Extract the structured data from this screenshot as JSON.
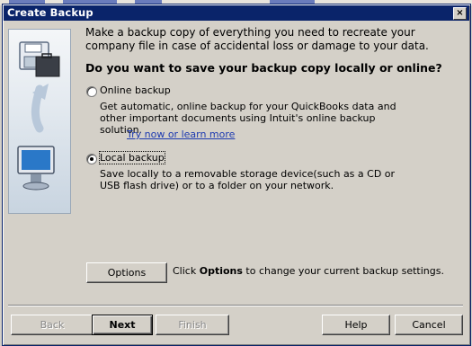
{
  "window": {
    "title": "Create Backup",
    "close_label": "×"
  },
  "intro_text": "Make a backup copy of everything you need to recreate your company file in case of accidental loss or damage to your data.",
  "question": "Do you want to save your backup copy locally or online?",
  "options": {
    "online": {
      "label": "Online backup",
      "selected": false,
      "description": "Get automatic, online backup for your QuickBooks data and other important documents using Intuit's online backup solution.",
      "link": "Try now or learn more"
    },
    "local": {
      "label": "Local backup",
      "selected": true,
      "description": "Save locally to a removable storage device(such as a CD or USB flash drive) or to a folder on your network."
    }
  },
  "options_button": {
    "label": "Options",
    "hint_prefix": "Click ",
    "hint_bold": "Options",
    "hint_suffix": " to change your current backup settings."
  },
  "footer": {
    "back": "Back",
    "next": "Next",
    "finish": "Finish",
    "help": "Help",
    "cancel": "Cancel"
  },
  "colors": {
    "titlebar": "#0a246a",
    "dialog_bg": "#d4d0c8",
    "link": "#1d3ab0"
  },
  "icons": [
    "floppy-disk-with-folder-icon",
    "curved-arrow-icon",
    "computer-monitor-icon"
  ]
}
